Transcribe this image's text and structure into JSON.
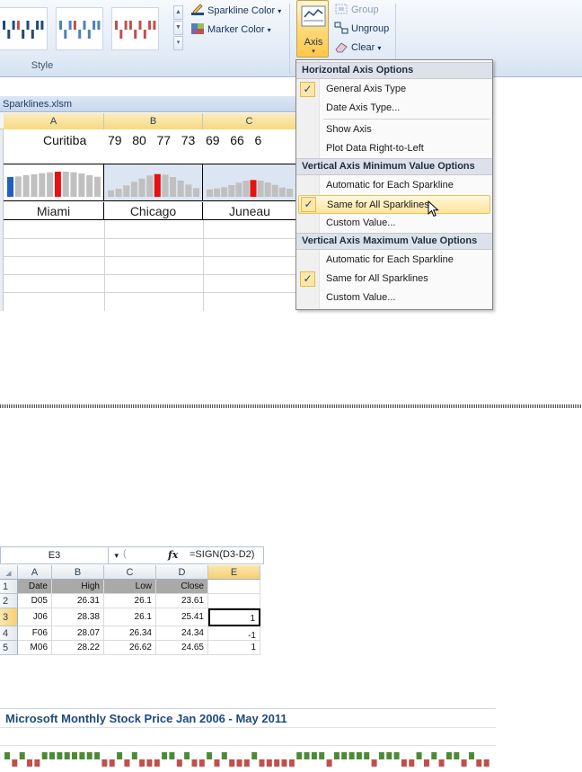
{
  "ribbon": {
    "style_group_label": "Style",
    "sparkline_color_label": "Sparkline Color",
    "marker_color_label": "Marker Color",
    "axis_label": "Axis",
    "group_label": "Group",
    "ungroup_label": "Ungroup",
    "clear_label": "Clear",
    "dropdown_arrow": "▾",
    "gallery_styles": [
      {
        "color": "#1f497d"
      },
      {
        "color": "#4f81bd"
      },
      {
        "color": "#c0504d"
      }
    ]
  },
  "workbook": {
    "title": "Sparklines.xlsm",
    "columns": [
      "A",
      "B",
      "C"
    ],
    "row_text": "Curitiba",
    "row_values": "79   80   77   73   69   66   6",
    "cities": [
      "Miami",
      "Chicago",
      "Juneau"
    ],
    "sparklines": [
      {
        "values": [
          66,
          68,
          72,
          75,
          79,
          82,
          84,
          84,
          82,
          78,
          72,
          67
        ],
        "highlight_first": true,
        "high_index": 6
      },
      {
        "values": [
          22,
          27,
          38,
          50,
          61,
          71,
          76,
          74,
          66,
          54,
          41,
          29
        ],
        "high_index": 6
      },
      {
        "values": [
          25,
          28,
          32,
          39,
          47,
          54,
          56,
          54,
          48,
          40,
          31,
          27
        ],
        "high_index": 6
      }
    ]
  },
  "axis_menu": {
    "sections": [
      {
        "header": "Horizontal Axis Options",
        "items": [
          {
            "label": "General Axis Type",
            "checked": true
          },
          {
            "label": "Date Axis Type...",
            "checked": false
          },
          {
            "separator": true
          },
          {
            "label": "Show Axis",
            "checked": false
          },
          {
            "label": "Plot Data Right-to-Left",
            "checked": false
          }
        ]
      },
      {
        "header": "Vertical Axis Minimum Value Options",
        "items": [
          {
            "label": "Automatic for Each Sparkline",
            "checked": false
          },
          {
            "label": "Same for All Sparklines",
            "checked": true,
            "highlighted": true
          },
          {
            "label": "Custom Value...",
            "checked": false
          }
        ]
      },
      {
        "header": "Vertical Axis Maximum Value Options",
        "items": [
          {
            "label": "Automatic for Each Sparkline",
            "checked": false
          },
          {
            "label": "Same for All Sparklines",
            "checked": true
          },
          {
            "label": "Custom Value...",
            "checked": false
          }
        ]
      }
    ],
    "check_glyph": "✓"
  },
  "formula_bar": {
    "cell_ref": "E3",
    "fx": "fx",
    "formula": "=SIGN(D3-D2)"
  },
  "sheet": {
    "columns": [
      "A",
      "B",
      "C",
      "D",
      "E"
    ],
    "selected_column": "E",
    "selected_row": "3",
    "rows": [
      {
        "num": "1",
        "cells": [
          "Date",
          "High",
          "Low",
          "Close",
          ""
        ]
      },
      {
        "num": "2",
        "cells": [
          "D05",
          "26.31",
          "26.1",
          "23.61",
          ""
        ]
      },
      {
        "num": "3",
        "cells": [
          "J06",
          "28.38",
          "26.1",
          "25.41",
          "1"
        ]
      },
      {
        "num": "4",
        "cells": [
          "F06",
          "28.07",
          "26.34",
          "24.34",
          "-1"
        ]
      },
      {
        "num": "5",
        "cells": [
          "M06",
          "28.22",
          "26.62",
          "24.65",
          "1"
        ]
      }
    ]
  },
  "winloss_chart": {
    "title": "Microsoft Monthly Stock Price Jan 2006 - May 2011",
    "win_color": "#4e8a36",
    "loss_color": "#c0504d"
  },
  "chart_data": {
    "type": "bar",
    "title": "Microsoft Monthly Stock Price Jan 2006 - May 2011",
    "series": [
      {
        "values": [
          1,
          -1,
          1,
          -1,
          -1,
          1,
          1,
          1,
          1,
          1,
          1,
          1,
          1,
          -1,
          -1,
          1,
          -1,
          1,
          -1,
          -1,
          -1,
          1,
          1,
          -1,
          1,
          -1,
          -1,
          1,
          -1,
          1,
          -1,
          -1,
          -1,
          1,
          -1,
          -1,
          -1,
          -1,
          -1,
          1,
          1,
          1,
          1,
          -1,
          1,
          1,
          1,
          1,
          1,
          -1,
          1,
          1,
          1,
          -1,
          -1,
          1,
          -1,
          1,
          -1,
          1,
          1,
          -1,
          1,
          -1,
          -1
        ]
      }
    ],
    "ylim": [
      -1,
      1
    ]
  }
}
